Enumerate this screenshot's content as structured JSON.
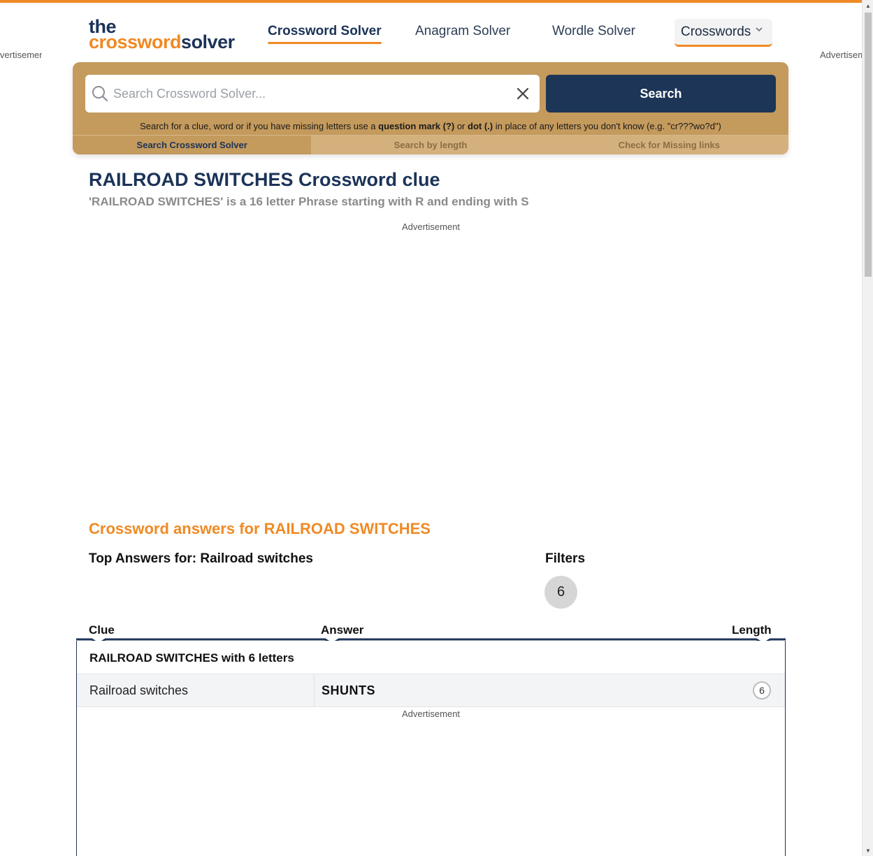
{
  "side_ads": {
    "left": "Advertisement",
    "right": "Advertisement"
  },
  "logo": {
    "line1": "the",
    "line2a": "crossword",
    "line2b": "solver"
  },
  "nav": {
    "items": [
      "Crossword Solver",
      "Anagram Solver",
      "Wordle Solver"
    ],
    "dropdown": "Crosswords"
  },
  "search": {
    "placeholder": "Search Crossword Solver...",
    "button": "Search",
    "hint_a": "Search for a clue, word or if you have missing letters use a ",
    "hint_b": "question mark (?)",
    "hint_c": " or ",
    "hint_d": "dot (.)",
    "hint_e": " in place of any letters you don't know (e.g. \"cr???wo?d\")",
    "tabs": [
      "Search Crossword Solver",
      "Search by length",
      "Check for Missing links"
    ]
  },
  "title": "RAILROAD SWITCHES Crossword clue",
  "subtitle": "'RAILROAD SWITCHES' is a 16 letter Phrase starting with R and ending with S",
  "ad_label": "Advertisement",
  "answers": {
    "heading": "Crossword answers for RAILROAD SWITCHES",
    "top_label": "Top Answers for: Railroad switches",
    "filters_label": "Filters",
    "filter_chip": "6",
    "columns": {
      "clue": "Clue",
      "answer": "Answer",
      "length": "Length"
    },
    "group_title": "RAILROAD SWITCHES with 6 letters",
    "rows": [
      {
        "clue": "Railroad switches",
        "answer": "SHUNTS",
        "length": "6"
      }
    ]
  }
}
